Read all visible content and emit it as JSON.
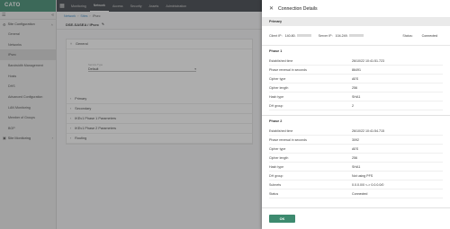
{
  "brand": {
    "logo": "CATO"
  },
  "sidebar": {
    "groups": [
      {
        "label": "Site Configuration",
        "items": [
          "General",
          "Networks",
          "IPsec",
          "Bandwidth Management",
          "Hosts",
          "DHS",
          "Advanced Configuration",
          "LAN Monitoring",
          "Member of Groups",
          "BGP"
        ]
      },
      {
        "label": "Site Monitoring",
        "items": []
      }
    ],
    "active_item": "IPsec"
  },
  "topnav": {
    "tabs": [
      "Monitoring",
      "Network",
      "Access",
      "Security",
      "Assets",
      "Administration"
    ],
    "active_tab": "Network"
  },
  "breadcrumb": {
    "items": [
      "Network",
      "Sites",
      "IPsec"
    ]
  },
  "subheader": {
    "title": "DSE-SASEA / IPsec"
  },
  "general": {
    "label": "General",
    "field_label": "Service Type",
    "field_value": "Default"
  },
  "collapsed_sections": [
    "Primary",
    "Secondary",
    "IKEv1 Phase 1 Parameters",
    "IKEv1 Phase 2 Parameters",
    "Routing"
  ],
  "drawer": {
    "title": "Connection Details",
    "primary_label": "Primary",
    "client_ip_label": "Client IP:",
    "client_ip_value": "140.80.",
    "server_ip_label": "Server IP:",
    "server_ip_value": "104.249.",
    "status_label": "Status:",
    "status_value": "Connected",
    "phase1": {
      "title": "Phase 1",
      "rows": [
        {
          "k": "Established time",
          "v": "26/10/22 10:41:51.723"
        },
        {
          "k": "Phase renewal in seconds",
          "v": "86491"
        },
        {
          "k": "Cipher type",
          "v": "AES"
        },
        {
          "k": "Cipher length",
          "v": "256"
        },
        {
          "k": "Hash type",
          "v": "SHA1"
        },
        {
          "k": "DH group",
          "v": "2"
        }
      ]
    },
    "phase2": {
      "title": "Phase 2",
      "rows": [
        {
          "k": "Established time",
          "v": "26/10/22 10:41:54.715"
        },
        {
          "k": "Phase renewal in seconds",
          "v": "3092"
        },
        {
          "k": "Cipher type",
          "v": "AES"
        },
        {
          "k": "Cipher length",
          "v": "256"
        },
        {
          "k": "Hash type",
          "v": "SHA1"
        },
        {
          "k": "DH group",
          "v": "Not using PFS"
        },
        {
          "k": "Subnets",
          "v": "0.0.0.0/0 <-> 0.0.0.0/0"
        },
        {
          "k": "Status",
          "v": "Connected"
        }
      ]
    },
    "ok_label": "OK"
  },
  "colors": {
    "brand": "#3d8a6f",
    "topnav": "#3a3f45",
    "connected": "#2e9a4e",
    "link": "#2f7fc1"
  }
}
